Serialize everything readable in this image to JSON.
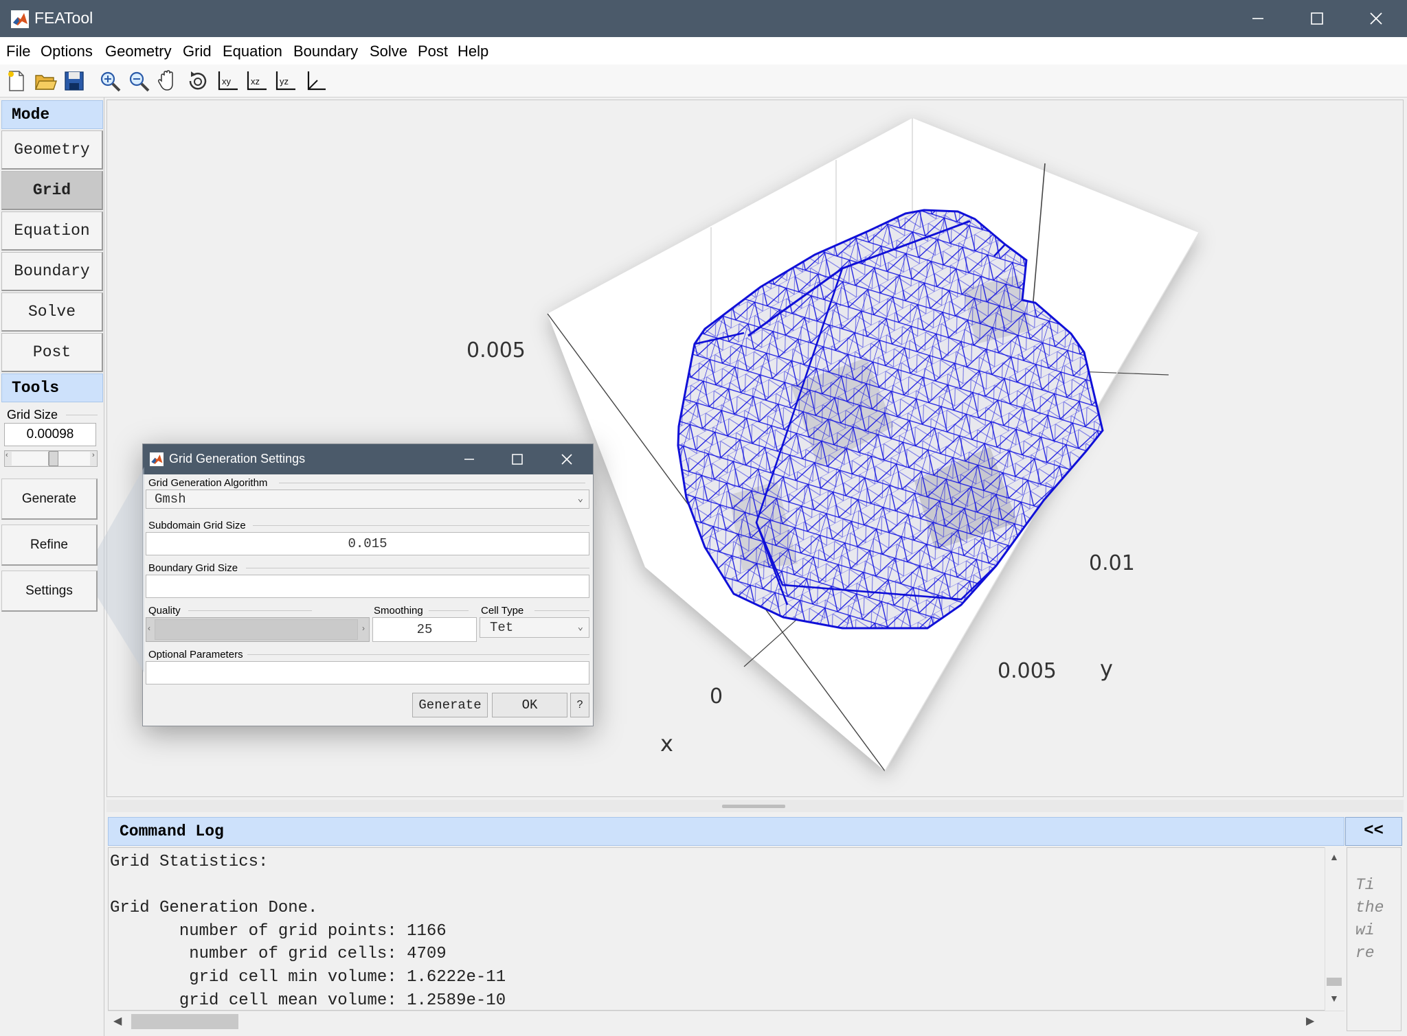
{
  "window": {
    "title": "FEATool"
  },
  "menu": [
    "File",
    "Options",
    "Geometry",
    "Grid",
    "Equation",
    "Boundary",
    "Solve",
    "Post",
    "Help"
  ],
  "toolbar": [
    "new-icon",
    "open-icon",
    "save-icon",
    "zoom-in-icon",
    "zoom-out-icon",
    "pan-icon",
    "rotate-3d-icon",
    "view-xy-icon",
    "view-xz-icon",
    "view-yz-icon",
    "view-3d-axes-icon"
  ],
  "sidebar": {
    "mode_header": "Mode",
    "modes": [
      "Geometry",
      "Grid",
      "Equation",
      "Boundary",
      "Solve",
      "Post"
    ],
    "active_mode": "Grid",
    "tools_header": "Tools",
    "grid_size_label": "Grid Size",
    "grid_size_value": "0.00098",
    "buttons": [
      "Generate",
      "Refine",
      "Settings"
    ]
  },
  "plot": {
    "labels": {
      "z_tick": "0.005",
      "y_tick_1": "0.01",
      "y_tick_2": "0.005",
      "x_tick": "0",
      "y_axis": "y",
      "x_axis": "x"
    },
    "mesh_color": "#1515e0"
  },
  "dialog": {
    "title": "Grid Generation Settings",
    "algorithm_label": "Grid Generation Algorithm",
    "algorithm_value": "Gmsh",
    "subdomain_label": "Subdomain Grid Size",
    "subdomain_value": "0.015",
    "boundary_label": "Boundary Grid Size",
    "boundary_value": "",
    "quality_label": "Quality",
    "smoothing_label": "Smoothing",
    "smoothing_value": "25",
    "celltype_label": "Cell Type",
    "celltype_value": "Tet",
    "optional_label": "Optional Parameters",
    "optional_value": "",
    "generate_button": "Generate",
    "ok_button": "OK",
    "help_button": "?"
  },
  "cmdlog": {
    "header": "Command Log",
    "collapse_label": "<<",
    "lines": [
      "Grid Statistics:",
      "",
      "Grid Generation Done.",
      "       number of grid points: 1166",
      "        number of grid cells: 4709",
      "        grid cell min volume: 1.6222e-11",
      "       grid cell mean volume: 1.2589e-10"
    ],
    "tips_lines": [
      "Ti",
      "the",
      "wi",
      "re"
    ]
  }
}
